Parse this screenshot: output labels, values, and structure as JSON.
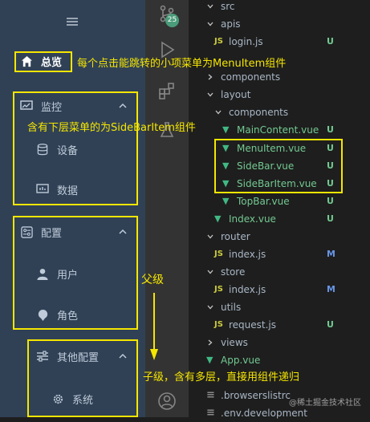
{
  "sidebar": {
    "home_label": "总览",
    "monitor": {
      "label": "监控",
      "items": [
        "设备",
        "数据"
      ]
    },
    "config": {
      "label": "配置",
      "items": [
        "用户",
        "角色"
      ]
    },
    "other_config": {
      "label": "其他配置",
      "items": [
        "系统"
      ]
    }
  },
  "activity_bar": {
    "scm_badge": "25"
  },
  "explorer": {
    "rows": [
      {
        "label": "src",
        "kind": "folder",
        "state": "open",
        "status": ""
      },
      {
        "label": "apis",
        "kind": "folder",
        "state": "open",
        "status": ""
      },
      {
        "label": "login.js",
        "kind": "js",
        "status": "U"
      },
      {
        "label": "components",
        "kind": "folder",
        "state": "closed",
        "status": ""
      },
      {
        "label": "layout",
        "kind": "folder",
        "state": "open",
        "status": ""
      },
      {
        "label": "components",
        "kind": "folder",
        "state": "open",
        "status": ""
      },
      {
        "label": "MainContent.vue",
        "kind": "vue",
        "status": "U"
      },
      {
        "label": "MenuItem.vue",
        "kind": "vue",
        "status": "U"
      },
      {
        "label": "SideBar.vue",
        "kind": "vue",
        "status": "U"
      },
      {
        "label": "SideBarItem.vue",
        "kind": "vue",
        "status": "U"
      },
      {
        "label": "TopBar.vue",
        "kind": "vue",
        "status": "U"
      },
      {
        "label": "Index.vue",
        "kind": "vue",
        "status": "U"
      },
      {
        "label": "router",
        "kind": "folder",
        "state": "open",
        "status": ""
      },
      {
        "label": "index.js",
        "kind": "js",
        "status": "M"
      },
      {
        "label": "store",
        "kind": "folder",
        "state": "open",
        "status": ""
      },
      {
        "label": "index.js",
        "kind": "js",
        "status": "M"
      },
      {
        "label": "utils",
        "kind": "folder",
        "state": "open",
        "status": ""
      },
      {
        "label": "request.js",
        "kind": "js",
        "status": "U"
      },
      {
        "label": "views",
        "kind": "folder",
        "state": "closed",
        "status": ""
      },
      {
        "label": "App.vue",
        "kind": "vue",
        "status": ""
      },
      {
        "label": ".browserslistrc",
        "kind": "file",
        "status": ""
      },
      {
        "label": ".env.development",
        "kind": "file",
        "status": ""
      }
    ]
  },
  "annotations": {
    "menuitem_note": "每个点击能跳转的小项菜单为MenuItem组件",
    "sidebaritem_note": "含有下层菜单的为SideBarItem组件",
    "parent_label": "父级",
    "child_note": "子级，含有多层，直接用组件递归"
  },
  "watermark": "@稀土掘金技术社区",
  "colors": {
    "sidebar_bg": "#304156",
    "annotation": "#f5e600",
    "vue_untracked": "#73c991",
    "modified": "#6796e6"
  }
}
